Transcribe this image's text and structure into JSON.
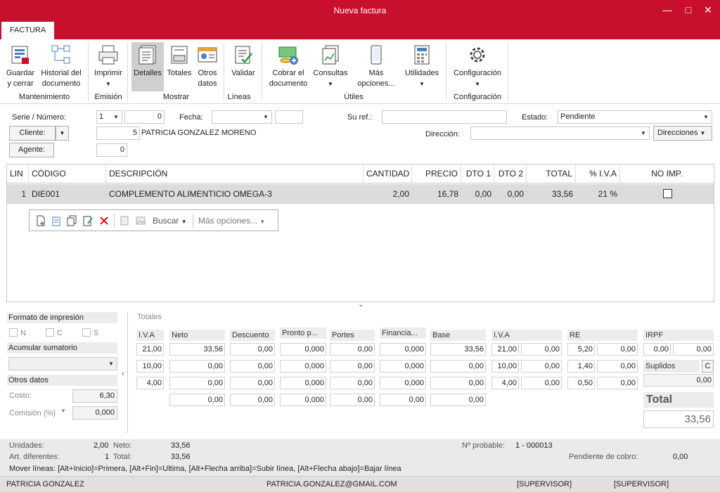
{
  "window": {
    "title": "Nueva factura"
  },
  "ribbon": {
    "tab": "FACTURA",
    "buttons": {
      "guardar": "Guardar\ny cerrar",
      "historial": "Historial del\ndocumento",
      "imprimir": "Imprimir",
      "detalles": "Detalles",
      "totales": "Totales",
      "otros": "Otros\ndatos",
      "validar": "Validar",
      "cobrar": "Cobrar el\ndocumento",
      "consultas": "Consultas",
      "mas": "Más\nopciones...",
      "utilidades": "Utilidades",
      "configuracion": "Configuración"
    },
    "groups": {
      "mantenimiento": "Mantenimiento",
      "emision": "Emisión",
      "mostrar": "Mostrar",
      "lineas": "Líneas",
      "utiles": "Útiles",
      "configuracion": "Configuración"
    }
  },
  "header": {
    "serie_label": "Serie / Número:",
    "serie_value": "1",
    "numero_value": "0",
    "fecha_label": "Fecha:",
    "fecha_value": "",
    "suref_label": "Su ref.:",
    "suref_value": "",
    "estado_label": "Estado:",
    "estado_value": "Pendiente",
    "cliente_label": "Cliente:",
    "cliente_code": "5",
    "cliente_name": "PATRICIA GONZALEZ MORENO",
    "direccion_label": "Dirección:",
    "direccion_value": "",
    "direcciones_button": "Direcciones",
    "agente_label": "Agente:",
    "agente_value": "0"
  },
  "grid": {
    "columns": [
      "LIN",
      "CÓDIGO",
      "DESCRIPCIÓN",
      "CANTIDAD",
      "PRECIO",
      "DTO 1",
      "DTO 2",
      "TOTAL",
      "% I.V.A",
      "NO IMP."
    ],
    "rows": [
      {
        "lin": "1",
        "codigo": "DIE001",
        "descripcion": "COMPLEMENTO ALIMENTICIO OMEGA-3",
        "cantidad": "2,00",
        "precio": "16,78",
        "dto1": "0,00",
        "dto2": "0,00",
        "total": "33,56",
        "iva": "21 %"
      }
    ],
    "toolbar": {
      "buscar": "Buscar",
      "mas_opciones": "Más opciones..."
    }
  },
  "left_panel": {
    "formato_title": "Formato de impresión",
    "formato_opts": [
      "N",
      "C",
      "S"
    ],
    "acumular_title": "Acumular sumatorio",
    "otros_title": "Otros datos",
    "costo_label": "Costo:",
    "costo_value": "6,30",
    "comision_label": "Comisión (%)",
    "comision_value": "0,000"
  },
  "totales": {
    "title": "Totales",
    "headers": [
      "I.V.A",
      "Neto",
      "Descuento",
      "Pronto p...",
      "Portes",
      "Financia...",
      "Base",
      "I.V.A",
      "RE",
      "IRPF"
    ],
    "rows": [
      [
        "21,00",
        "33,56",
        "0,00",
        "0,000",
        "0,00",
        "0,000",
        "33,56",
        "21,00",
        "0,00",
        "5,20",
        "0,00"
      ],
      [
        "10,00",
        "0,00",
        "0,00",
        "0,000",
        "0,00",
        "0,000",
        "0,00",
        "10,00",
        "0,00",
        "1,40",
        "0,00"
      ],
      [
        "4,00",
        "0,00",
        "0,00",
        "0,000",
        "0,00",
        "0,000",
        "0,00",
        "4,00",
        "0,00",
        "0,50",
        "0,00"
      ]
    ],
    "sum_row": [
      "0,00",
      "0,00",
      "0,000",
      "0,00",
      "0,00",
      "0,00"
    ],
    "irpf": [
      "0,00",
      "0,00"
    ],
    "suplidos_label": "Suplidos",
    "suplidos_btn": "C",
    "suplidos_value": "0,00",
    "total_label": "Total",
    "total_value": "33,56"
  },
  "status": {
    "unidades_label": "Unidades:",
    "unidades_value": "2,00",
    "neto_label": "Neto:",
    "neto_value": "33,56",
    "artdif_label": "Art. diferentes:",
    "artdif_value": "1",
    "total_label": "Total:",
    "total_value": "33,56",
    "nprob_label": "Nº probable:",
    "nprob_value": "1 - 000013",
    "pend_label": "Pendiente de cobro:",
    "pend_value": "0,00",
    "mover": "Mover líneas: [Alt+Inicio]=Primera, [Alt+Fin]=Ultima, [Alt+Flecha arriba]=Subir línea, [Alt+Flecha abajo]=Bajar línea"
  },
  "footer": {
    "user": "PATRICIA GONZALEZ",
    "email": "PATRICIA.GONZALEZ@GMAIL.COM",
    "sup1": "[SUPERVISOR]",
    "sup2": "[SUPERVISOR]"
  }
}
